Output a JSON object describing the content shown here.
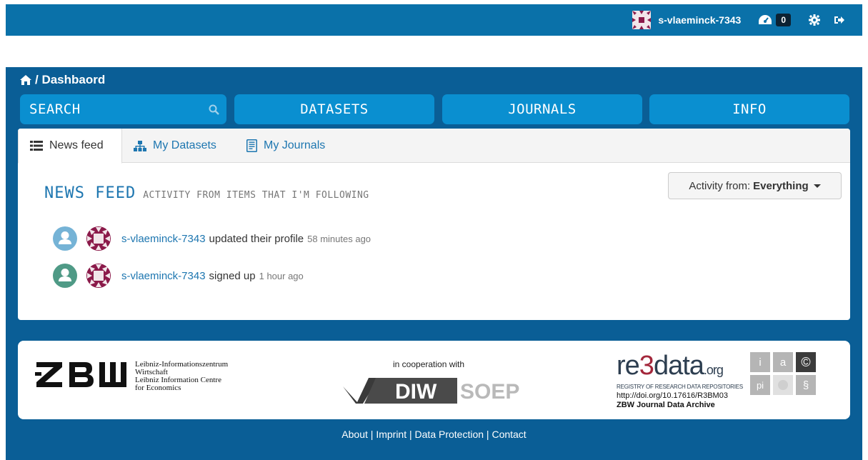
{
  "account": {
    "username": "s-vlaeminck-7343",
    "dashboard_count": "0",
    "icons": [
      "identicon-avatar",
      "dashboard-icon",
      "gear-icon",
      "sign-out-icon"
    ]
  },
  "breadcrumb": {
    "label": "/ Dashbaord",
    "icon": "home-icon"
  },
  "nav": {
    "search_label": "SEARCH",
    "datasets_label": "DATASETS",
    "journals_label": "JOURNALS",
    "info_label": "INFO"
  },
  "tabs": [
    {
      "label": "News feed",
      "icon": "list-icon",
      "active": true
    },
    {
      "label": "My Datasets",
      "icon": "sitemap-icon",
      "active": false
    },
    {
      "label": "My Journals",
      "icon": "book-icon",
      "active": false
    }
  ],
  "newsfeed": {
    "title": "NEWS FEED",
    "subtitle": "ACTIVITY FROM ITEMS THAT I'M FOLLOWING",
    "activity_label": "Activity from:",
    "activity_value": "Everything",
    "items": [
      {
        "user": "s-vlaeminck-7343",
        "action": "updated their profile",
        "time": "58 minutes ago"
      },
      {
        "user": "s-vlaeminck-7343",
        "action": "signed up",
        "time": "1 hour ago"
      }
    ]
  },
  "partners": {
    "zbw_text": [
      "Leibniz-Informationszentrum",
      "Wirtschaft",
      "Leibniz Information Centre",
      "for Economics"
    ],
    "cooperation": "in cooperation with",
    "diw": "DIW",
    "soep": "SOEP",
    "re3data": {
      "brand_re": "re",
      "brand_3": "3",
      "brand_data": "data",
      "brand_org": ".org",
      "registry": "REGISTRY OF RESEARCH DATA REPOSITORIES",
      "doi": "http://doi.org/10.17616/R3BM03",
      "archive": "ZBW Journal Data Archive",
      "grid": [
        "i",
        "a",
        "©",
        "pi",
        "",
        "§"
      ]
    }
  },
  "footer": {
    "about": "About",
    "imprint": "Imprint",
    "data_protection": "Data Protection",
    "contact": "Contact",
    "separator": " | "
  },
  "colors": {
    "topbar": "#0a71a9",
    "main": "#0a5e96",
    "nav_button": "#0a8fd0",
    "link": "#1d76b0",
    "avatar": "#8b1a4a"
  }
}
